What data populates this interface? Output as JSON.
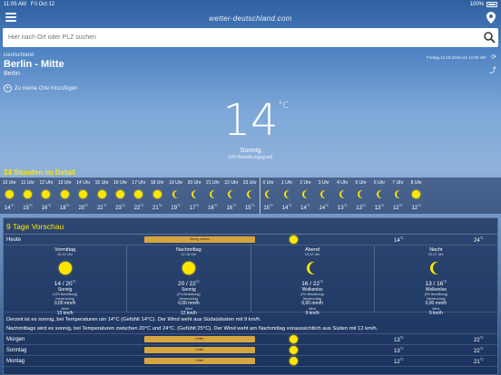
{
  "status": {
    "time": "11:05 AM",
    "date": "Fri Oct 12",
    "battery": "100%"
  },
  "app": {
    "brand": "wetter-deutschland.com",
    "search_placeholder": "Hier nach Ort oder PLZ suchen"
  },
  "location": {
    "country": "Deutschland",
    "city": "Berlin - Mitte",
    "state": "Berlin",
    "add_favorite": "Zu meine Orte hinzufügen",
    "updated": "Freitag 12.10.2018 um 11:00 Uhr"
  },
  "current": {
    "temp": "14",
    "unit": "°C",
    "condition": "Sonnig",
    "cloud": "(0% Bewölkungsgrad)"
  },
  "hours_title": "24 Stunden im Detail",
  "hours": [
    {
      "label": "10 Uhr",
      "icon": "sun",
      "temp": "14"
    },
    {
      "label": "11 Uhr",
      "icon": "sun",
      "temp": "15"
    },
    {
      "label": "12 Uhr",
      "icon": "sun",
      "temp": "16"
    },
    {
      "label": "13 Uhr",
      "icon": "sun",
      "temp": "18"
    },
    {
      "label": "14 Uhr",
      "icon": "sun",
      "temp": "20"
    },
    {
      "label": "15 Uhr",
      "icon": "sun",
      "temp": "22"
    },
    {
      "label": "16 Uhr",
      "icon": "sun",
      "temp": "23"
    },
    {
      "label": "17 Uhr",
      "icon": "sun",
      "temp": "22"
    },
    {
      "label": "18 Uhr",
      "icon": "sun",
      "temp": "21"
    },
    {
      "label": "19 Uhr",
      "icon": "moon",
      "temp": "19"
    },
    {
      "label": "20 Uhr",
      "icon": "moon",
      "temp": "17"
    },
    {
      "label": "21 Uhr",
      "icon": "moon",
      "temp": "16"
    },
    {
      "label": "22 Uhr",
      "icon": "moon",
      "temp": "16"
    },
    {
      "label": "23 Uhr",
      "icon": "moon",
      "temp": "15"
    },
    {
      "label": "0 Uhr",
      "icon": "moon",
      "temp": "15"
    },
    {
      "label": "1 Uhr",
      "icon": "moon",
      "temp": "14"
    },
    {
      "label": "2 Uhr",
      "icon": "moon",
      "temp": "14"
    },
    {
      "label": "3 Uhr",
      "icon": "moon",
      "temp": "14"
    },
    {
      "label": "4 Uhr",
      "icon": "moon",
      "temp": "13"
    },
    {
      "label": "5 Uhr",
      "icon": "moon",
      "temp": "13"
    },
    {
      "label": "6 Uhr",
      "icon": "moon",
      "temp": "13"
    },
    {
      "label": "7 Uhr",
      "icon": "moon",
      "temp": "12"
    },
    {
      "label": "8 Uhr",
      "icon": "sun",
      "temp": "12"
    }
  ],
  "forecast": {
    "title": "9 Tage Vorschau",
    "today": {
      "name": "Heute",
      "bar": "Wenig wolken",
      "min": "14",
      "max": "24"
    },
    "periods": [
      {
        "name": "Vormittag",
        "time": "10-12 Uhr",
        "icon": "sun",
        "temp": "14 / 20",
        "cond": "Sonnig",
        "cloud": "(14% Bewölkung)",
        "rain_label": "Niederschlag",
        "rain": "0,00 mm/h",
        "wind_label": "Wind",
        "wind": "13 km/h"
      },
      {
        "name": "Nachmittag",
        "time": "12-18 Uhr",
        "icon": "sun",
        "temp": "20 / 22",
        "cond": "Sonnig",
        "cloud": "(2% Bewölkung)",
        "rain_label": "Niederschlag",
        "rain": "0,00 mm/h",
        "wind_label": "Wind",
        "wind": "12 km/h"
      },
      {
        "name": "Abend",
        "time": "18-22 Uhr",
        "icon": "moon",
        "temp": "16 / 22",
        "cond": "Wolkenlos",
        "cloud": "(0% Bewölkung)",
        "rain_label": "Niederschlag",
        "rain": "0,00 mm/h",
        "wind_label": "Wind",
        "wind": "9 km/h"
      },
      {
        "name": "Nacht",
        "time": "22-07 Uhr",
        "icon": "moon",
        "temp": "13 / 16",
        "cond": "Wolkenlos",
        "cloud": "(0% Bewölkung)",
        "rain_label": "Niederschlag",
        "rain": "0,00 mm/h",
        "wind_label": "Wind",
        "wind": "9 km/h"
      }
    ],
    "text1": "Derzeit ist es sonnig, bei Temperaturen um 14°C (Gefühlt 14°C). Der Wind weht aus Südsüdosten mit 9 km/h.",
    "text2": "Nachmittags wird es sonnig, bei Temperaturen zwischen 20°C und 24°C. (Gefühlt 25°C). Der Wind weht am Nachmittag voraussichtlich aus Süden mit 12 km/h.",
    "days": [
      {
        "name": "Morgen",
        "bar": "Heiter",
        "min": "13",
        "max": "22"
      },
      {
        "name": "Sonntag",
        "bar": "Heiter",
        "min": "13",
        "max": "22"
      },
      {
        "name": "Montag",
        "bar": "Heiter",
        "min": "12",
        "max": "21"
      }
    ]
  },
  "colors": {
    "accent": "#ffe600",
    "bar": "#d7a53f"
  }
}
